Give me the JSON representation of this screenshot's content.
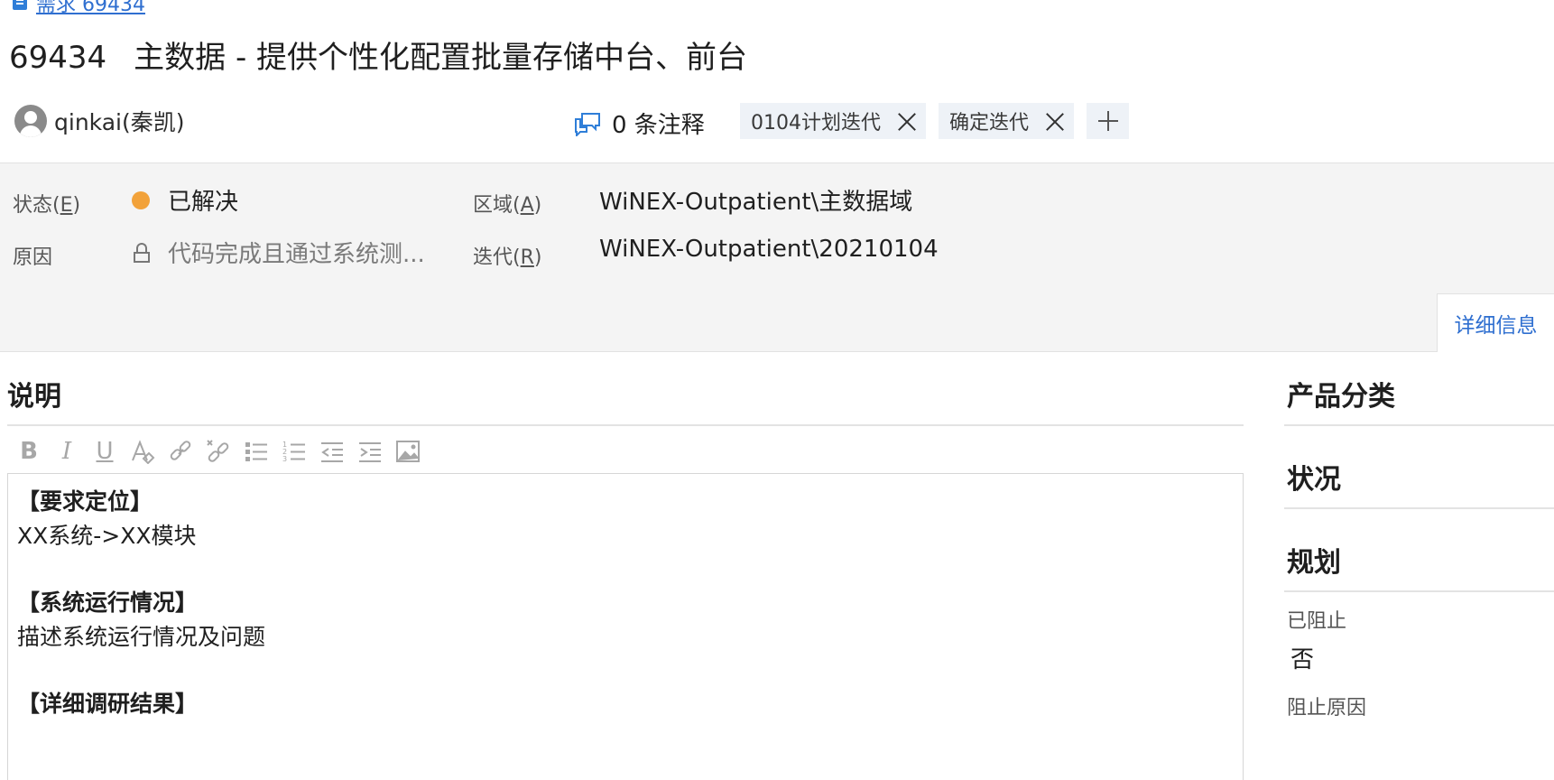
{
  "breadcrumb": {
    "link_text": "需求 69434"
  },
  "work_item": {
    "id": "69434",
    "title": "主数据 - 提供个性化配置批量存储中台、前台"
  },
  "assignee": {
    "name": "qinkai(秦凯)"
  },
  "comments": {
    "label": "0 条注释"
  },
  "tags": [
    {
      "label": "0104计划迭代"
    },
    {
      "label": "确定迭代"
    }
  ],
  "fields": {
    "state": {
      "label": "状态",
      "accesskey": "E",
      "value": "已解决",
      "color": "#f2a23a"
    },
    "reason": {
      "label": "原因",
      "value": "代码完成且通过系统测..."
    },
    "area": {
      "label": "区域",
      "accesskey": "A",
      "value": "WiNEX-Outpatient\\主数据域"
    },
    "iteration": {
      "label": "迭代",
      "accesskey": "R",
      "value": "WiNEX-Outpatient\\20210104"
    }
  },
  "tabs": {
    "details": "详细信息"
  },
  "description": {
    "heading": "说明",
    "lines": [
      {
        "text": "【要求定位】",
        "bold": true
      },
      {
        "text": "XX系统->XX模块",
        "bold": false
      },
      {
        "text": "【系统运行情况】",
        "bold": true
      },
      {
        "text": "描述系统运行情况及问题",
        "bold": false
      },
      {
        "text": "【详细调研结果】",
        "bold": true
      }
    ]
  },
  "toolbar_icons": [
    "bold-icon",
    "italic-icon",
    "underline-icon",
    "clear-format-icon",
    "link-icon",
    "unlink-icon",
    "bulleted-list-icon",
    "numbered-list-icon",
    "outdent-icon",
    "indent-icon",
    "image-icon"
  ],
  "right_panel": {
    "product_category": "产品分类",
    "status": "状况",
    "planning": "规划",
    "blocked_label": "已阻止",
    "blocked_value": "否",
    "block_reason_label": "阻止原因"
  },
  "colors": {
    "accent": "#2f6fd0",
    "state_resolved": "#f2a23a",
    "tag_bg": "#eef2f7"
  }
}
